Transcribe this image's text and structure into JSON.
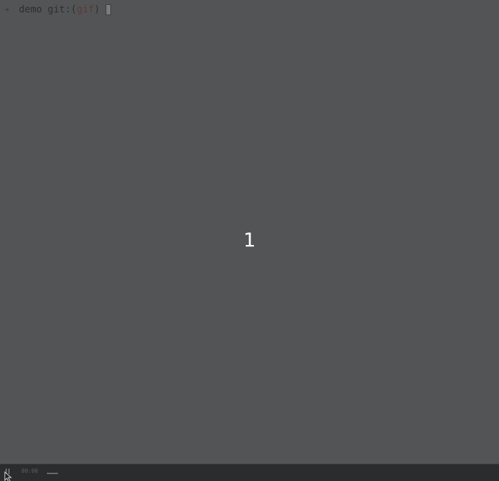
{
  "terminal": {
    "prompt_arrow": "➜",
    "directory": "demo",
    "git_prefix": "git:(",
    "branch": "gif",
    "git_suffix": ")",
    "countdown": "1"
  },
  "controls": {
    "time": "00:00",
    "progress": 0.025
  },
  "icons": {
    "pause": "pause-icon",
    "cursor": "mouse-pointer-icon"
  },
  "colors": {
    "background": "#535456",
    "controls_bar": "#2b2c2e",
    "countdown_text": "#ffffff",
    "branch": "#5a3a34"
  }
}
